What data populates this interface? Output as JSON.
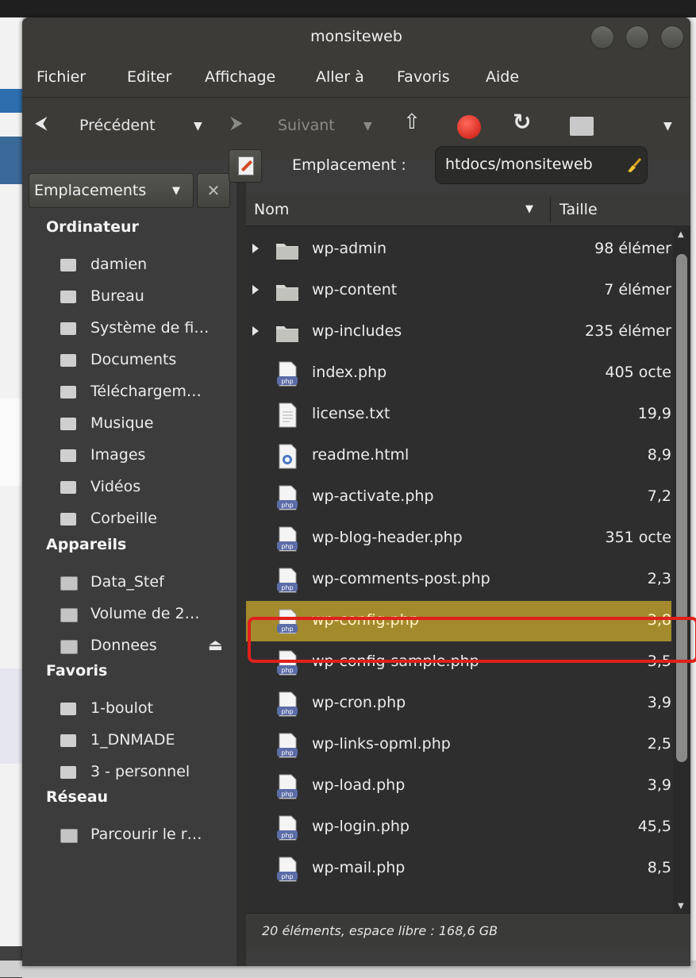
{
  "window": {
    "title": "monsiteweb"
  },
  "menu": [
    "Fichier",
    "Editer",
    "Affichage",
    "Aller à",
    "Favoris",
    "Aide"
  ],
  "toolbar": {
    "back_label": "Précédent",
    "forward_label": "Suivant"
  },
  "sidebar": {
    "header": "Emplacements",
    "sections": {
      "computer": "Ordinateur",
      "devices": "Appareils",
      "favorites": "Favoris",
      "network": "Réseau"
    },
    "computer_items": [
      "damien",
      "Bureau",
      "Système de fi…",
      "Documents",
      "Téléchargem…",
      "Musique",
      "Images",
      "Vidéos",
      "Corbeille"
    ],
    "device_items": [
      "Data_Stef",
      "Volume de 2…",
      "Donnees"
    ],
    "favorite_items": [
      "1-boulot",
      "1_DNMADE",
      "3 - personnel"
    ],
    "network_items": [
      "Parcourir le r…"
    ]
  },
  "location": {
    "label": "Emplacement :",
    "value": "htdocs/monsiteweb"
  },
  "columns": {
    "name": "Nom",
    "size": "Taille"
  },
  "files": [
    {
      "name": "wp-admin",
      "size": "98 élémer",
      "type": "folder"
    },
    {
      "name": "wp-content",
      "size": "7 élémer",
      "type": "folder"
    },
    {
      "name": "wp-includes",
      "size": "235 élémer",
      "type": "folder"
    },
    {
      "name": "index.php",
      "size": "405 octe",
      "type": "php"
    },
    {
      "name": "license.txt",
      "size": "19,9",
      "type": "text"
    },
    {
      "name": "readme.html",
      "size": "8,9",
      "type": "html"
    },
    {
      "name": "wp-activate.php",
      "size": "7,2",
      "type": "php"
    },
    {
      "name": "wp-blog-header.php",
      "size": "351 octe",
      "type": "php"
    },
    {
      "name": "wp-comments-post.php",
      "size": "2,3",
      "type": "php"
    },
    {
      "name": "wp-config.php",
      "size": "3,8",
      "type": "php",
      "selected": true
    },
    {
      "name": "wp-config-sample.php",
      "size": "3,5",
      "type": "php"
    },
    {
      "name": "wp-cron.php",
      "size": "3,9",
      "type": "php"
    },
    {
      "name": "wp-links-opml.php",
      "size": "2,5",
      "type": "php"
    },
    {
      "name": "wp-load.php",
      "size": "3,9",
      "type": "php"
    },
    {
      "name": "wp-login.php",
      "size": "45,5",
      "type": "php"
    },
    {
      "name": "wp-mail.php",
      "size": "8,5",
      "type": "php"
    }
  ],
  "status": "20 éléments, espace libre : 168,6 GB",
  "colors": {
    "selection": "#a38a2d",
    "annotation": "#e0201b",
    "panel": "#3c3b37"
  }
}
